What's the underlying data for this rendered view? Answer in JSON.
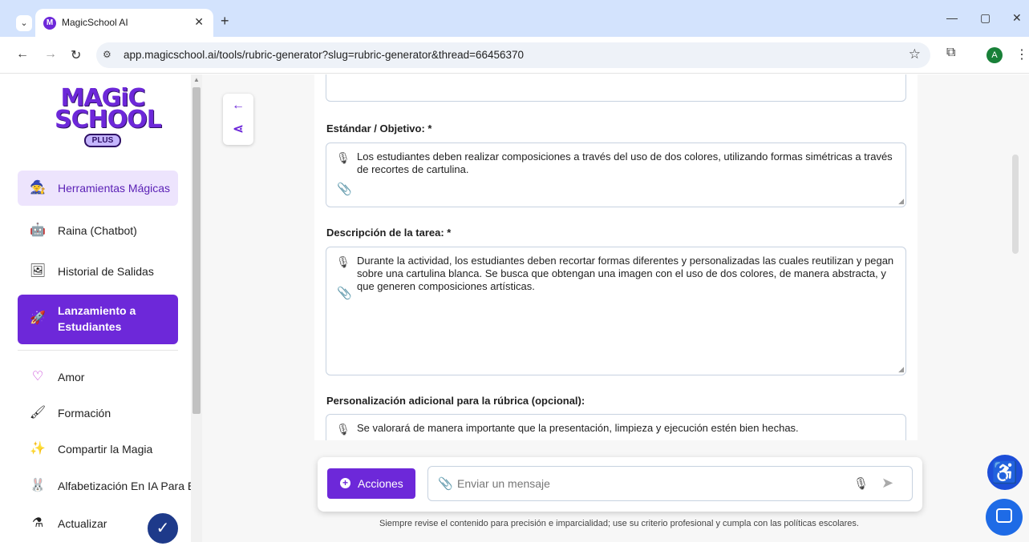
{
  "browser": {
    "tab_title": "MagicSchool AI",
    "tab_favicon_letter": "M",
    "url": "app.magicschool.ai/tools/rubric-generator?slug=rubric-generator&thread=66456370",
    "profile_letter": "A",
    "new_tab": "+",
    "minimize": "—",
    "maximize": "▢",
    "close": "✕"
  },
  "sidebar": {
    "logo_line1": "MAGiC",
    "logo_line2": "SCHOOL",
    "logo_plus": "PLUS",
    "items": [
      {
        "label": "Herramientas Mágicas",
        "icon": "wizard-icon"
      },
      {
        "label": "Raina (Chatbot)",
        "icon": "robot-icon"
      },
      {
        "label": "Historial de Salidas",
        "icon": "history-icon"
      },
      {
        "label": "Lanzamiento a Estudiantes",
        "icon": "rocket-icon"
      },
      {
        "label": "Amor",
        "icon": "heart-icon"
      },
      {
        "label": "Formación",
        "icon": "easel-icon"
      },
      {
        "label": "Compartir la Magia",
        "icon": "sparkle-icon"
      },
      {
        "label": "Alfabetización En IA Para E",
        "icon": "bunny-icon"
      },
      {
        "label": "Actualizar",
        "icon": "potion-icon"
      }
    ]
  },
  "form": {
    "field1_label": "Estándar / Objetivo: *",
    "field1_value": "Los estudiantes deben realizar composiciones a través del uso de dos colores, utilizando formas simétricas a través de recortes de cartulina.",
    "field2_label": "Descripción de la tarea: *",
    "field2_value": "Durante la actividad, los estudiantes deben recortar formas diferentes y personalizadas las cuales reutilizan y pegan sobre una cartulina blanca. Se busca que obtengan una imagen con el uso de dos colores, de manera abstracta, y que generen composiciones artísticas.",
    "field3_label": "Personalización adicional para la rúbrica (opcional):",
    "field3_value": "Se valorará de manera importante que la presentación, limpieza y ejecución estén bien hechas."
  },
  "composer": {
    "actions_label": "Acciones",
    "placeholder": "Enviar un mensaje"
  },
  "disclaimer": "Siempre revise el contenido para precisión e imparcialidad; use su criterio profesional y cumpla con las políticas escolares."
}
